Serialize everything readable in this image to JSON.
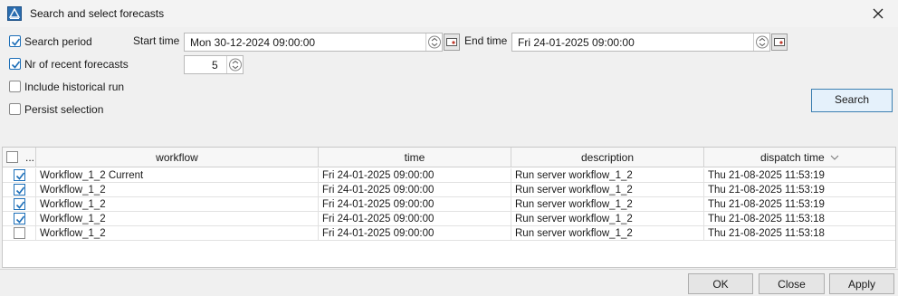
{
  "window": {
    "title": "Search and select forecasts"
  },
  "filters": {
    "search_period_label": "Search period",
    "search_period_checked": true,
    "start_time_label": "Start time",
    "start_time_value": "Mon 30-12-2024 09:00:00",
    "end_time_label": "End time",
    "end_time_value": "Fri 24-01-2025 09:00:00",
    "recent_label": "Nr of recent forecasts",
    "recent_checked": true,
    "recent_value": "5",
    "historical_label": "Include historical run",
    "historical_checked": false,
    "persist_label": "Persist selection",
    "persist_checked": false,
    "search_button": "Search"
  },
  "table": {
    "columns": [
      "...",
      "workflow",
      "time",
      "description",
      "dispatch time"
    ],
    "rows": [
      {
        "checked": true,
        "workflow": "Workflow_1_2 Current",
        "time": "Fri 24-01-2025 09:00:00",
        "description": "Run server workflow_1_2",
        "dispatch": "Thu 21-08-2025 11:53:19"
      },
      {
        "checked": true,
        "workflow": "Workflow_1_2",
        "time": "Fri 24-01-2025 09:00:00",
        "description": "Run server workflow_1_2",
        "dispatch": "Thu 21-08-2025 11:53:19"
      },
      {
        "checked": true,
        "workflow": "Workflow_1_2",
        "time": "Fri 24-01-2025 09:00:00",
        "description": "Run server workflow_1_2",
        "dispatch": "Thu 21-08-2025 11:53:19"
      },
      {
        "checked": true,
        "workflow": "Workflow_1_2",
        "time": "Fri 24-01-2025 09:00:00",
        "description": "Run server workflow_1_2",
        "dispatch": "Thu 21-08-2025 11:53:18"
      },
      {
        "checked": false,
        "workflow": "Workflow_1_2",
        "time": "Fri 24-01-2025 09:00:00",
        "description": "Run server workflow_1_2",
        "dispatch": "Thu 21-08-2025 11:53:18"
      }
    ]
  },
  "footer": {
    "ok": "OK",
    "close": "Close",
    "apply": "Apply"
  },
  "colors": {
    "accent": "#1d6fb8",
    "window_bg": "#f0f0f0",
    "table_border": "#c8c8c8"
  },
  "icons": {
    "app": "forecast-app-icon",
    "close": "close-icon",
    "calendar": "calendar-icon",
    "spinner": "spinner-icon",
    "sort": "sort-desc-icon",
    "check": "checkmark-icon"
  }
}
